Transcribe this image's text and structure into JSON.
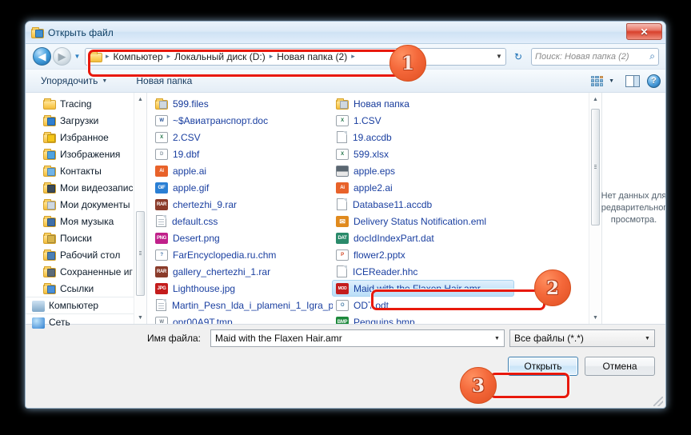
{
  "window": {
    "title": "Открыть файл",
    "title_icon": "app-folder-icon",
    "close_label": "✕"
  },
  "nav": {
    "back_icon": "◀",
    "forward_icon": "▶",
    "recent_caret": "▼",
    "address_caret": "▼",
    "refresh_icon": "↻",
    "breadcrumbs": [
      {
        "label": "Компьютер"
      },
      {
        "label": "Локальный диск (D:)"
      },
      {
        "label": "Новая папка (2)"
      }
    ],
    "separator": "▸",
    "search_placeholder": "Поиск: Новая папка (2)",
    "search_icon": "⌕"
  },
  "toolbar": {
    "organize_label": "Упорядочить",
    "organize_caret": "▼",
    "new_folder_label": "Новая папка",
    "view_caret": "▼",
    "help_label": "?"
  },
  "sidebar": {
    "items": [
      {
        "label": "Tracing",
        "icon": "folder-icon",
        "overlay": ""
      },
      {
        "label": "Загрузки",
        "icon": "folder-icon",
        "overlay": "#2f7fd0"
      },
      {
        "label": "Избранное",
        "icon": "folder-icon",
        "overlay": "#f5c518"
      },
      {
        "label": "Изображения",
        "icon": "folder-icon",
        "overlay": "#4fa3e0"
      },
      {
        "label": "Контакты",
        "icon": "folder-icon",
        "overlay": "#6fb3e8"
      },
      {
        "label": "Мои видеозапис",
        "icon": "folder-icon",
        "overlay": "#3a4a5a"
      },
      {
        "label": "Мои документы",
        "icon": "folder-icon",
        "overlay": "#cfd8e0"
      },
      {
        "label": "Моя музыка",
        "icon": "folder-icon",
        "overlay": "#3f6fa8"
      },
      {
        "label": "Поиски",
        "icon": "folder-icon",
        "overlay": "#d8b44a"
      },
      {
        "label": "Рабочий стол",
        "icon": "folder-icon",
        "overlay": "#4a7fb5"
      },
      {
        "label": "Сохраненные иг",
        "icon": "folder-icon",
        "overlay": "#5c6b78"
      },
      {
        "label": "Ссылки",
        "icon": "folder-icon",
        "overlay": "#4a90d9"
      }
    ],
    "roots": [
      {
        "label": "Компьютер",
        "icon": "computer-icon"
      },
      {
        "label": "Сеть",
        "icon": "network-icon"
      }
    ]
  },
  "files": {
    "column1": [
      {
        "name": "599.files",
        "icon": "folder-icon",
        "type": "folder"
      },
      {
        "name": "~$Авиатранспорт.doc",
        "icon": "word-icon",
        "type": "doc",
        "tag": "W",
        "color": "#2a5699"
      },
      {
        "name": "2.CSV",
        "icon": "excel-icon",
        "type": "doc",
        "tag": "X",
        "color": "#1e7145"
      },
      {
        "name": "19.dbf",
        "icon": "dbf-icon",
        "type": "doc",
        "tag": "D",
        "color": "#8c9aa5"
      },
      {
        "name": "apple.ai",
        "icon": "illustrator-icon",
        "type": "doc",
        "tag": "Ai",
        "color": "#e8622a"
      },
      {
        "name": "apple.gif",
        "icon": "gif-icon",
        "type": "doc",
        "tag": "GIF",
        "color": "#2a7fd4"
      },
      {
        "name": "chertezhi_9.rar",
        "icon": "rar-icon",
        "type": "doc",
        "tag": "RAR",
        "color": "#8a3b2a"
      },
      {
        "name": "default.css",
        "icon": "generic-file-icon",
        "type": "plain"
      },
      {
        "name": "Desert.png",
        "icon": "png-icon",
        "type": "doc",
        "tag": "PNG",
        "color": "#c0208a"
      },
      {
        "name": "FarEncyclopedia.ru.chm",
        "icon": "chm-icon",
        "type": "doc",
        "tag": "?",
        "color": "#3a6ea5"
      },
      {
        "name": "gallery_chertezhi_1.rar",
        "icon": "rar-icon",
        "type": "doc",
        "tag": "RAR",
        "color": "#8a3b2a"
      },
      {
        "name": "Lighthouse.jpg",
        "icon": "jpg-icon",
        "type": "doc",
        "tag": "JPG",
        "color": "#c41c1c"
      },
      {
        "name": "Martin_Pesn_lda_i_plameni_1_Igra_p...",
        "icon": "generic-file-icon",
        "type": "plain"
      },
      {
        "name": "opr00A9T.tmp",
        "icon": "tmp-icon",
        "type": "doc",
        "tag": "W",
        "color": "#6f7c88"
      }
    ],
    "column2": [
      {
        "name": "Новая папка",
        "icon": "folder-icon",
        "type": "folder"
      },
      {
        "name": "1.CSV",
        "icon": "excel-icon",
        "type": "doc",
        "tag": "X",
        "color": "#1e7145"
      },
      {
        "name": "19.accdb",
        "icon": "generic-file-icon",
        "type": "plain"
      },
      {
        "name": "599.xlsx",
        "icon": "excel-icon",
        "type": "doc",
        "tag": "X",
        "color": "#1e7145"
      },
      {
        "name": "apple.eps",
        "icon": "eps-icon",
        "type": "doc",
        "tag": "",
        "color": "#5a6670"
      },
      {
        "name": "apple2.ai",
        "icon": "illustrator-icon",
        "type": "doc",
        "tag": "Ai",
        "color": "#e8622a"
      },
      {
        "name": "Database11.accdb",
        "icon": "generic-file-icon",
        "type": "plain"
      },
      {
        "name": "Delivery Status Notification.eml",
        "icon": "mail-icon",
        "type": "doc",
        "tag": "✉",
        "color": "#e08a1e"
      },
      {
        "name": "docIdIndexPart.dat",
        "icon": "dat-icon",
        "type": "doc",
        "tag": "DAT",
        "color": "#2a8a6a"
      },
      {
        "name": "flower2.pptx",
        "icon": "powerpoint-icon",
        "type": "doc",
        "tag": "P",
        "color": "#d24726"
      },
      {
        "name": "ICEReader.hhc",
        "icon": "generic-file-icon",
        "type": "plain"
      },
      {
        "name": "Maid with the Flaxen Hair.amr",
        "icon": "amr-audio-icon",
        "type": "doc",
        "tag": "MOD",
        "color": "#c41c1c",
        "selected": true
      },
      {
        "name": "ODT.odt",
        "icon": "odt-icon",
        "type": "doc",
        "tag": "O",
        "color": "#4a7fa8"
      },
      {
        "name": "Penguins.bmp",
        "icon": "bmp-icon",
        "type": "doc",
        "tag": "BMP",
        "color": "#1e8a3c"
      }
    ]
  },
  "preview": {
    "message": "Нет данных для предварительного просмотра."
  },
  "footer": {
    "filename_label": "Имя файла:",
    "filename_value": "Maid with the Flaxen Hair.amr",
    "filter_value": "Все файлы (*.*)",
    "combo_caret": "▼",
    "open_button": "Открыть",
    "cancel_button": "Отмена"
  },
  "annotations": {
    "steps": [
      {
        "number": "1"
      },
      {
        "number": "2"
      },
      {
        "number": "3"
      }
    ]
  }
}
